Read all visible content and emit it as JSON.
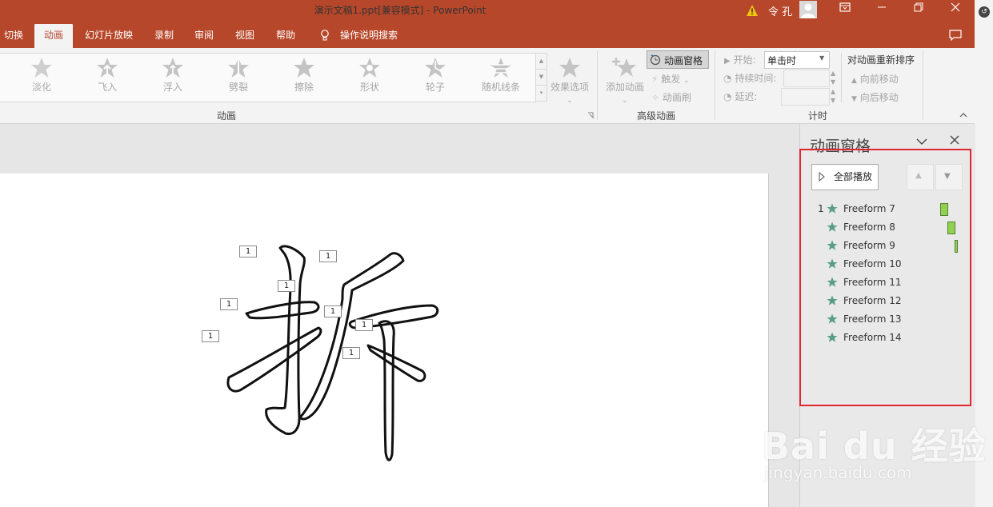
{
  "window": {
    "title": "演示文稿1.ppt[兼容模式] - PowerPoint",
    "user": "令 孔"
  },
  "tabs": [
    "切换",
    "动画",
    "幻灯片放映",
    "录制",
    "审阅",
    "视图",
    "帮助",
    "操作说明搜索"
  ],
  "active_tab": "动画",
  "ribbon": {
    "effects": [
      "淡化",
      "飞入",
      "浮入",
      "劈裂",
      "擦除",
      "形状",
      "轮子",
      "随机线条"
    ],
    "effect_options": "效果选项",
    "group_animation": "动画",
    "add_animation": "添加动画",
    "animation_pane": "动画窗格",
    "trigger": "触发",
    "animation_painter": "动画刷",
    "group_advanced": "高级动画",
    "start_label": "开始:",
    "start_value": "单击时",
    "duration_label": "持续时间:",
    "delay_label": "延迟:",
    "group_timing": "计时",
    "reorder_title": "对动画重新排序",
    "move_earlier": "向前移动",
    "move_later": "向后移动"
  },
  "slide": {
    "tags": [
      "1",
      "1",
      "1",
      "1",
      "1",
      "1",
      "1",
      "1"
    ]
  },
  "pane": {
    "title": "动画窗格",
    "play_all": "全部播放",
    "items": [
      {
        "num": "1",
        "label": "Freeform 7",
        "timeline_fraction": 0.0
      },
      {
        "num": "",
        "label": "Freeform 8",
        "timeline_fraction": 0.4
      },
      {
        "num": "",
        "label": "Freeform 9",
        "timeline_fraction": 0.8
      },
      {
        "num": "",
        "label": "Freeform 10"
      },
      {
        "num": "",
        "label": "Freeform 11"
      },
      {
        "num": "",
        "label": "Freeform 12"
      },
      {
        "num": "",
        "label": "Freeform 13"
      },
      {
        "num": "",
        "label": "Freeform 14"
      }
    ]
  },
  "watermark": {
    "main": "Bai du 经验",
    "sub": "jingyan.baidu.com"
  },
  "colors": {
    "brand": "#b7472a",
    "highlight_box": "#e0262f",
    "timeline_bar": "#92d050",
    "effect_star": "#5a9e89"
  }
}
